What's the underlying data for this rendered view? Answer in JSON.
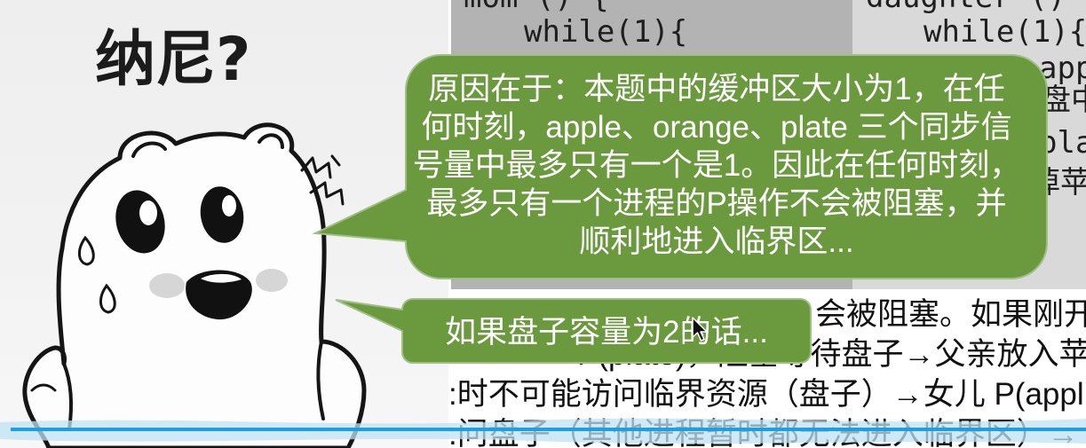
{
  "title": "纳尼?",
  "code": {
    "left": {
      "header": "mom () {",
      "loop": "while(1){"
    },
    "right": {
      "header": "daughter () {",
      "loop": "while(1){",
      "fragments": [
        "app",
        "盘中",
        "pla",
        "掉苹"
      ]
    }
  },
  "bubble_main": {
    "lines": [
      "原因在于：本题中的缓冲区大小为1，在任",
      "何时刻，apple、orange、plate 三个同步信",
      "号量中最多只有一个是1。因此在任何时刻，",
      "最多只有一个进程的P操作不会被阻塞，并",
      "顺利地进入临界区..."
    ]
  },
  "bubble_question": {
    "text": "如果盘子容量为2的话..."
  },
  "body_text": {
    "lines": [
      "会被阻塞。如果刚开",
      "P(plate)，阻塞等待盘子→父亲放入苹",
      ":时不可能访问临界资源（盘子）→女儿 P(appl",
      ":问盘子（其他进程暂时都无法进入临界区）→"
    ]
  },
  "icons": {
    "cursor": "mouse-pointer-icon",
    "sweat": "sweat-drop-icon",
    "stress": "stress-marks-icon",
    "character": "bear-character"
  },
  "colors": {
    "bubble_fill": "#6b9a3e",
    "bubble_border": "#9fbf86",
    "bubble_text": "#ffffff",
    "code_panel_dark": "#b3b3b3",
    "code_panel_light": "#d9d9d9",
    "wave_line": "#1e9fe2",
    "wave_band": "#bfe2f4",
    "text": "#111111",
    "illustration_bg": "#eeeeee"
  }
}
